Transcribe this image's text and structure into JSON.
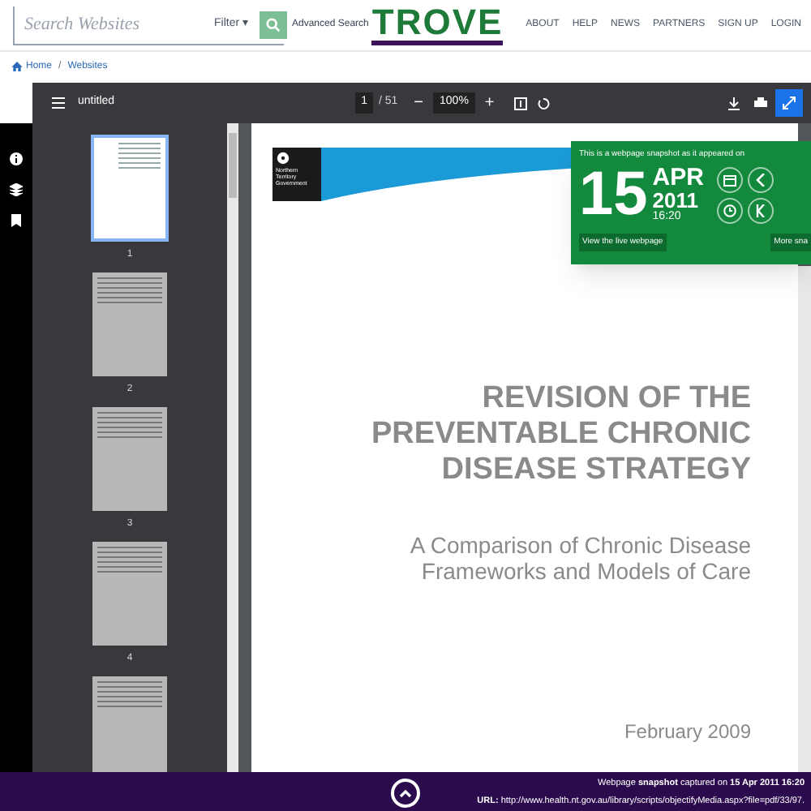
{
  "header": {
    "search": {
      "placeholder": "Search Websites"
    },
    "filter": "Filter ▾",
    "advanced_search": "Advanced Search",
    "logo": "TROVE",
    "nav": [
      "ABOUT",
      "HELP",
      "NEWS",
      "PARTNERS",
      "SIGN UP",
      "LOGIN"
    ]
  },
  "breadcrumb": [
    "Home",
    "Websites"
  ],
  "breadcrumb_separator": "/",
  "viewer": {
    "title": "untitled",
    "page": "1",
    "page_count": "/ 51",
    "zoom": "100%",
    "zoom_out": "−",
    "zoom_in": "+",
    "thumbnails": [
      {
        "label": "1",
        "selected": true
      },
      {
        "label": "2",
        "selected": false
      },
      {
        "label": "3",
        "selected": false
      },
      {
        "label": "4",
        "selected": false
      },
      {
        "selected": false
      }
    ],
    "document": {
      "org": "Northern Territory Government",
      "title": "REVISION OF THE PREVENTABLE CHRONIC DISEASE STRATEGY",
      "subtitle": "A Comparison of Chronic Disease Frameworks and Models of Care",
      "date": "February 2009"
    }
  },
  "snapshot": {
    "intro": "This is a webpage snapshot as it appeared on",
    "day": "15",
    "month": "APR",
    "year": "2011",
    "time": "16:20",
    "live_link": "View the live webpage",
    "more": "More sna"
  },
  "footer": {
    "captured": "Webpage **snapshot** captured on **15 Apr 2011 16:20**",
    "url": "**URL:** http://www.health.nt.gov.au/library/scripts/objectifyMedia.aspx?file=pdf/33/97."
  }
}
